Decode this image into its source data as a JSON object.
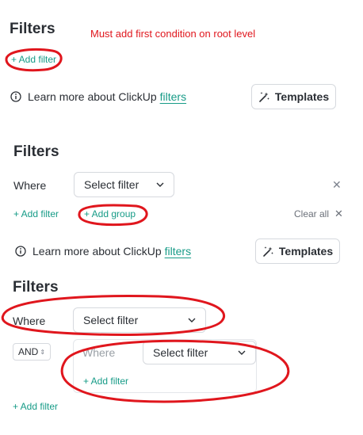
{
  "panel1": {
    "title": "Filters",
    "note": "Must add first condition on root level",
    "add_filter": "+ Add filter",
    "learn_text": "Learn more about ClickUp",
    "learn_link": "filters",
    "templates_label": "Templates"
  },
  "panel2": {
    "title": "Filters",
    "where": "Where",
    "select_placeholder": "Select filter",
    "add_filter": "+ Add filter",
    "add_group": "+ Add group",
    "clear_all": "Clear all",
    "learn_text": "Learn more about ClickUp",
    "learn_link": "filters",
    "templates_label": "Templates"
  },
  "panel3": {
    "title": "Filters",
    "where": "Where",
    "select_placeholder": "Select filter",
    "operator": "AND",
    "group_where": "Where",
    "group_select_placeholder": "Select filter",
    "group_add_filter": "+ Add filter",
    "add_filter": "+ Add filter"
  },
  "colors": {
    "accent": "#169b87",
    "annotation": "#e0161d",
    "text": "#2a2e34"
  },
  "icons": {
    "info": "info-icon",
    "templates": "magic-wand-icon",
    "close": "close-icon",
    "chevron": "chevron-down-icon"
  }
}
